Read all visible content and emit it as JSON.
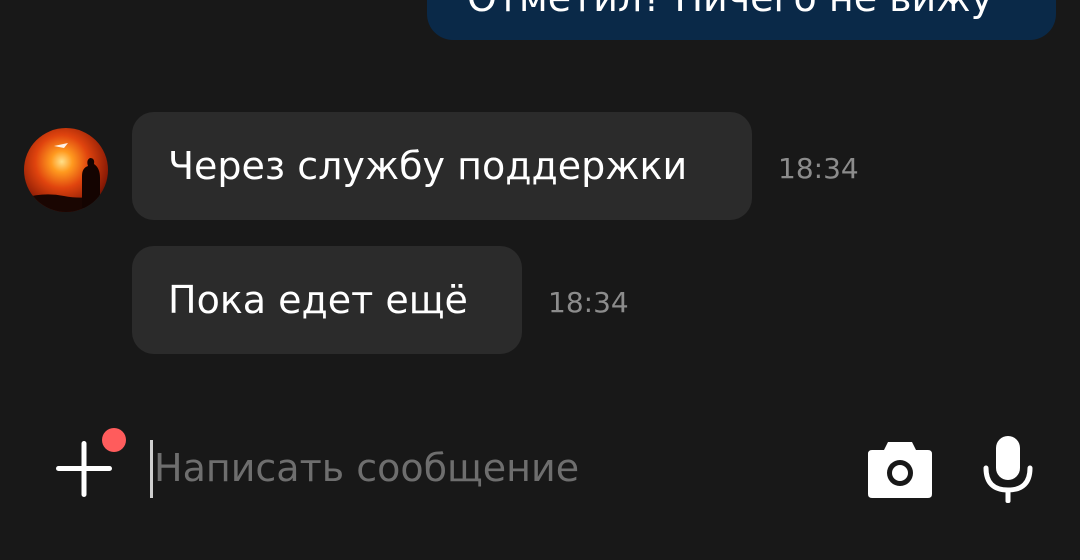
{
  "messages": {
    "outgoing_partial": "Отметил? Ничего не вижу",
    "incoming": [
      {
        "text": "Через службу поддержки",
        "time": "18:34"
      },
      {
        "text": "Пока едет ещё",
        "time": "18:34"
      }
    ]
  },
  "composer": {
    "placeholder": "Написать сообщение",
    "value": ""
  },
  "icons": {
    "attach": "plus-icon",
    "camera": "camera-icon",
    "mic": "microphone-icon",
    "notification_color": "#ff5c5c"
  },
  "colors": {
    "background": "#181818",
    "incoming_bubble": "#2b2b2b",
    "outgoing_bubble": "#0a2948"
  }
}
